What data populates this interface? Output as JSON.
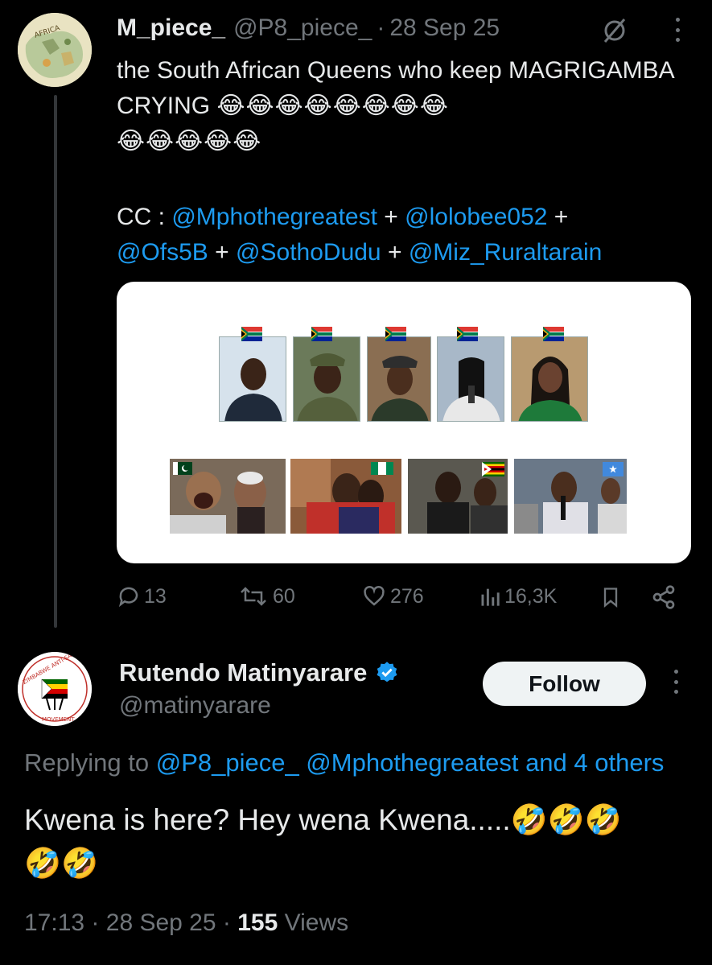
{
  "tweet": {
    "author_name": "M_piece_",
    "author_handle": "@P8_piece_",
    "separator": "·",
    "date": "28 Sep 25",
    "text": "the South African Queens who keep MAGRIGAMBA CRYING",
    "emojis_line1": "😂😂😂😂😂😂😂😂",
    "emojis_line2": "😂😂😂😂😂",
    "cc_label": "CC :",
    "plus": "+",
    "mentions": [
      "@Mphothegreatest",
      "@lolobee052",
      "@Ofs5B",
      "@SothoDudu",
      "@Miz_Ruraltarain"
    ],
    "avatar_text": "AFRICA",
    "stats": {
      "replies": "13",
      "reposts": "60",
      "likes": "276",
      "views": "16,3K"
    }
  },
  "reply": {
    "author_name": "Rutendo Matinyarare",
    "author_handle": "@matinyarare",
    "follow_label": "Follow",
    "avatar_text_top": "ZIMBABWE ANTI-SANCTIONS",
    "avatar_text_bottom": "MOVEMENT",
    "replying_prefix": "Replying to",
    "replying_mentions": "@P8_piece_ @Mphothegreatest",
    "replying_suffix": "and 4 others",
    "text": "Kwena is here? Hey wena Kwena.....",
    "emojis_line1": "🤣🤣🤣",
    "emojis_line2": "🤣🤣",
    "time": "17:13",
    "separator": "·",
    "date": "28 Sep 25",
    "views_count": "155",
    "views_label": "Views"
  },
  "colors": {
    "background": "#000000",
    "text": "#e7e9ea",
    "muted": "#71767b",
    "link": "#1d9bf0",
    "verified": "#1d9bf0"
  },
  "icons": [
    "grok-icon",
    "more-icon",
    "reply-icon",
    "repost-icon",
    "like-icon",
    "views-icon",
    "bookmark-icon",
    "share-icon",
    "verified-badge-icon"
  ]
}
